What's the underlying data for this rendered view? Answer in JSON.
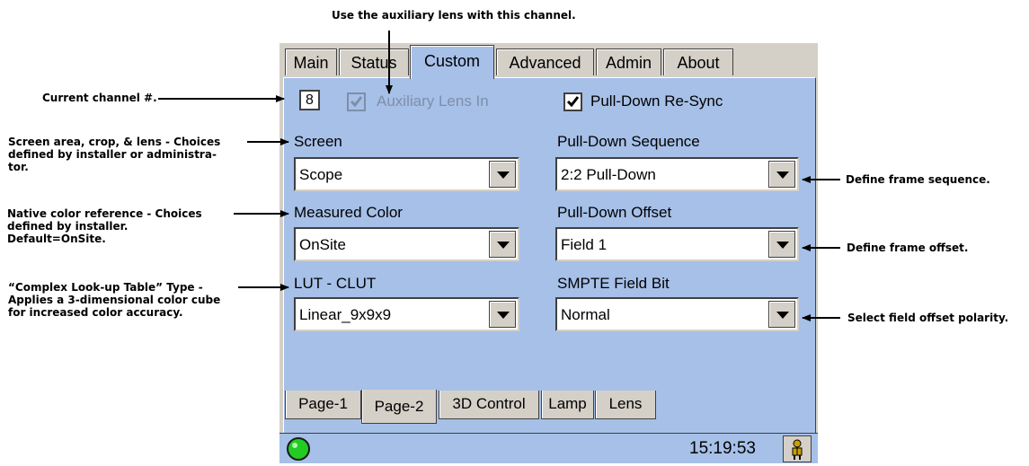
{
  "annotations": {
    "top": "Use the auxiliary lens with this channel.",
    "channel": "Current channel #.",
    "screen": [
      "Screen area, crop, & lens - Choices",
      "defined by installer or administra-",
      "tor."
    ],
    "measured": [
      "Native color reference - Choices",
      "defined by installer.",
      "Default=OnSite."
    ],
    "lut": [
      "“Complex Look-up Table” Type -",
      "Applies a 3-dimensional color cube",
      "for increased color accuracy."
    ],
    "frame_seq": "Define frame sequence.",
    "frame_offset": "Define frame offset.",
    "field_polarity": "Select field offset polarity."
  },
  "tabs": [
    "Main",
    "Status",
    "Custom",
    "Advanced",
    "Admin",
    "About"
  ],
  "selected_tab": "Custom",
  "channel": "8",
  "aux_lens": {
    "label": "Auxiliary Lens In",
    "checked": true,
    "disabled": true
  },
  "pulldown_resync": {
    "label": "Pull-Down Re-Sync",
    "checked": true
  },
  "fields": {
    "screen": {
      "label": "Screen",
      "value": "Scope"
    },
    "measured_color": {
      "label": "Measured Color",
      "value": "OnSite"
    },
    "lut": {
      "label": "LUT - CLUT",
      "value": "Linear_9x9x9"
    },
    "pulldown_sequence": {
      "label": "Pull-Down Sequence",
      "value": "2:2 Pull-Down"
    },
    "pulldown_offset": {
      "label": "Pull-Down Offset",
      "value": "Field 1"
    },
    "smpte": {
      "label": "SMPTE Field Bit",
      "value": "Normal"
    }
  },
  "bottom_tabs": [
    "Page-1",
    "Page-2",
    "3D Control",
    "Lamp",
    "Lens"
  ],
  "selected_bottom_tab": "Page-2",
  "status": {
    "time": "15:19:53",
    "led_color": "#22cc22",
    "led_icon": "status-led-icon",
    "user_icon": "user-icon"
  }
}
